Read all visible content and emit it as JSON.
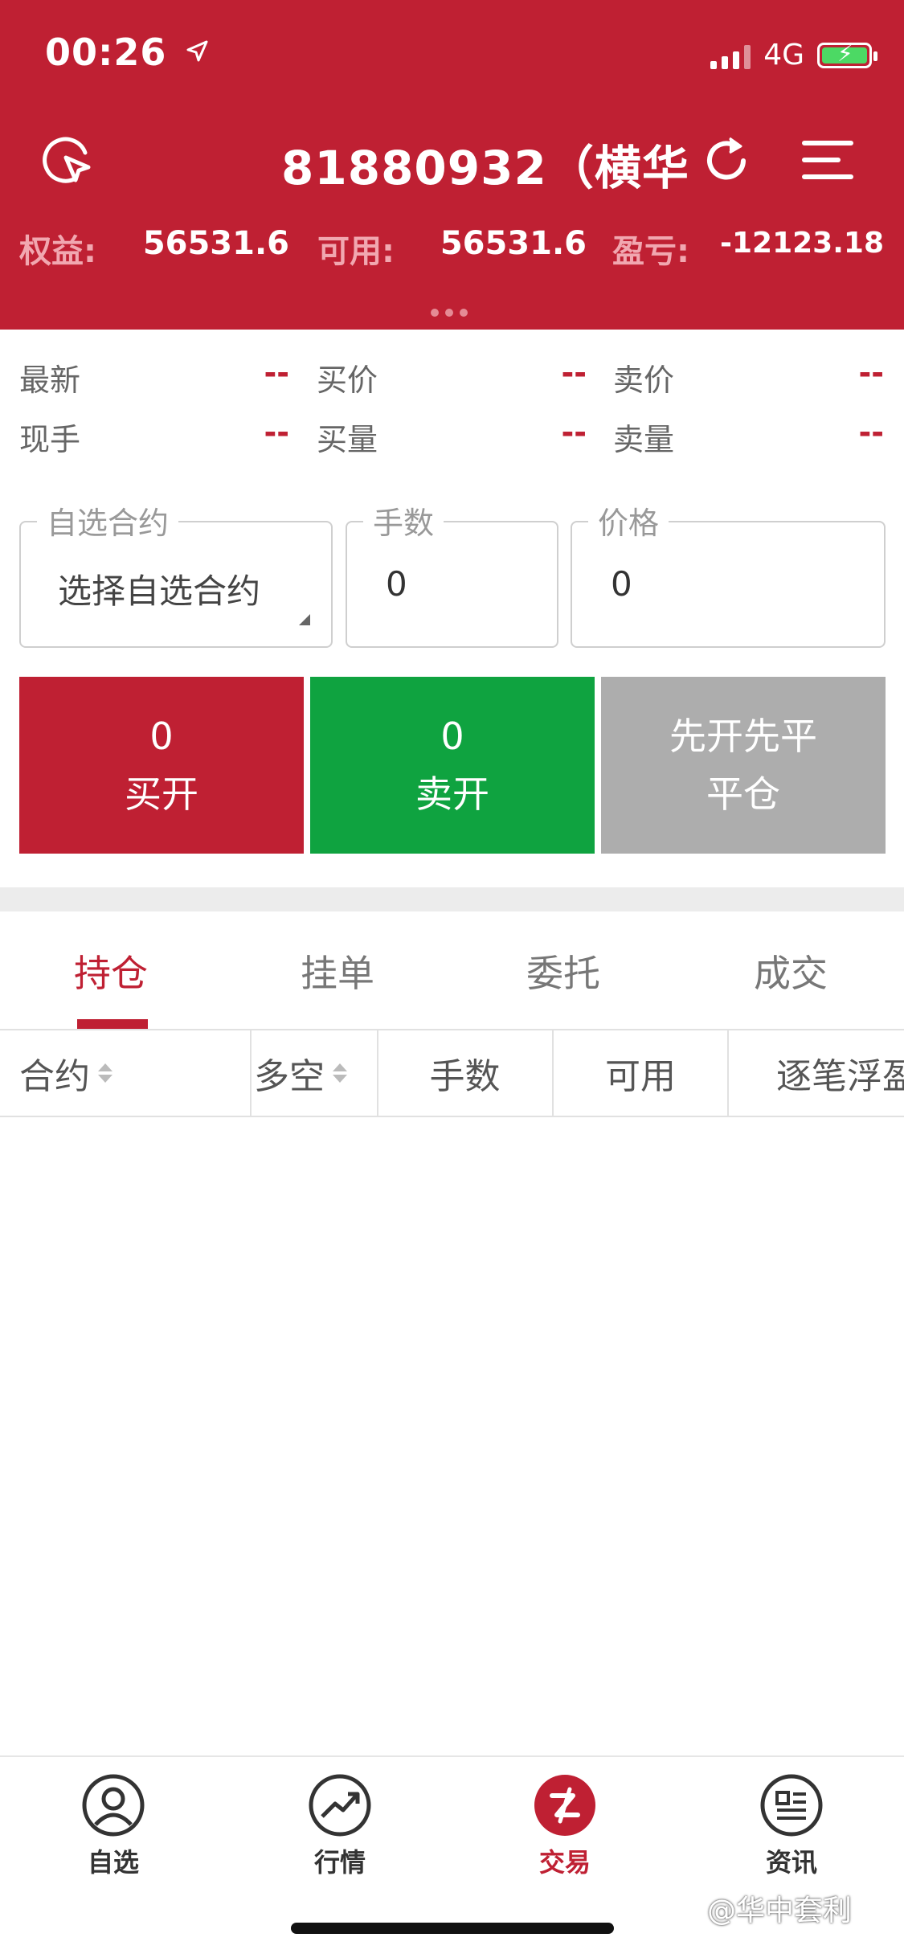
{
  "status_bar": {
    "time": "00:26",
    "network": "4G"
  },
  "header": {
    "title": "81880932（横华",
    "account": [
      {
        "label": "权益:",
        "value": "56531.6"
      },
      {
        "label": "可用:",
        "value": "56531.6"
      },
      {
        "label": "盈亏:",
        "value": "-12123.18"
      }
    ]
  },
  "quotes": {
    "row1": [
      {
        "label": "最新",
        "value": "--"
      },
      {
        "label": "买价",
        "value": "--"
      },
      {
        "label": "卖价",
        "value": "--"
      }
    ],
    "row2": [
      {
        "label": "现手",
        "value": "--"
      },
      {
        "label": "买量",
        "value": "--"
      },
      {
        "label": "卖量",
        "value": "--"
      }
    ]
  },
  "order_form": {
    "contract": {
      "legend": "自选合约",
      "value": "选择自选合约"
    },
    "quantity": {
      "legend": "手数",
      "value": "0"
    },
    "price": {
      "legend": "价格",
      "value": "0"
    }
  },
  "actions": {
    "buy_open": {
      "line1": "0",
      "line2": "买开",
      "color": "#bf2033"
    },
    "sell_open": {
      "line1": "0",
      "line2": "卖开",
      "color": "#0fa340"
    },
    "close": {
      "line1": "先开先平",
      "line2": "平仓",
      "color": "#adadad"
    }
  },
  "tabs": [
    "持仓",
    "挂单",
    "委托",
    "成交"
  ],
  "table_headers": [
    "合约",
    "多空",
    "手数",
    "可用",
    "逐笔浮盈"
  ],
  "bottom_nav": [
    {
      "label": "自选",
      "icon": "user-icon"
    },
    {
      "label": "行情",
      "icon": "trend-icon"
    },
    {
      "label": "交易",
      "icon": "trade-icon"
    },
    {
      "label": "资讯",
      "icon": "news-icon"
    }
  ],
  "watermark": "@华中套利",
  "colors": {
    "brand_red": "#bf2033",
    "buy_green": "#0fa340",
    "disabled_gray": "#adadad"
  }
}
